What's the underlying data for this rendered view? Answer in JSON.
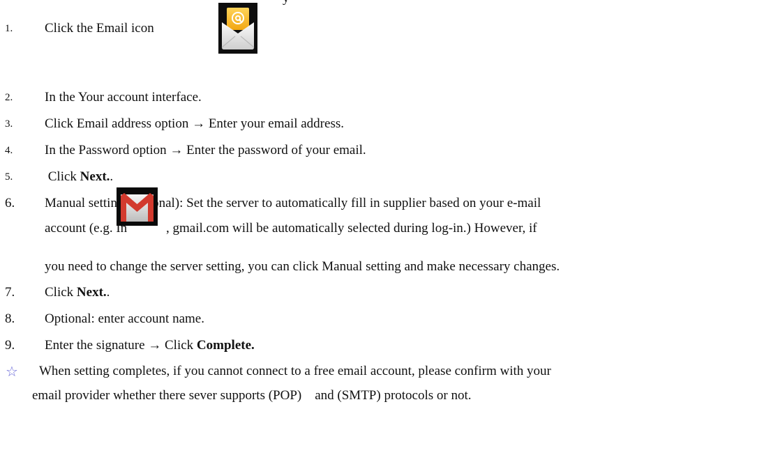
{
  "header_fragment": "y",
  "steps": [
    {
      "num": "1.",
      "parts": [
        {
          "text": "Click the Email icon",
          "bold": false
        }
      ]
    },
    {
      "num": "2.",
      "parts": [
        {
          "text": "In the Your account interface.",
          "bold": false
        }
      ]
    },
    {
      "num": "3.",
      "parts": [
        {
          "text": "Click Email address option → Enter your email address.",
          "bold": false
        }
      ]
    },
    {
      "num": "4.",
      "parts": [
        {
          "text": "In the Password option → Enter the password of your email.",
          "bold": false
        }
      ]
    },
    {
      "num": "5.",
      "parts": [
        {
          "text": " Click ",
          "bold": false
        },
        {
          "text": "Next.",
          "bold": true
        },
        {
          "text": ".",
          "bold": false
        }
      ]
    },
    {
      "num": "6.",
      "line1": "Manual setting (optional): Set the server to automatically fill in supplier based on your e-mail",
      "line2a": "account (e.g. In",
      "line2b": ", gmail.com will be automatically selected during log-in.) However, if",
      "line3": "you need to change the server setting, you can click Manual setting and make necessary changes."
    },
    {
      "num": "7.",
      "parts": [
        {
          "text": "Click ",
          "bold": false
        },
        {
          "text": "Next.",
          "bold": true
        },
        {
          "text": ".",
          "bold": false
        }
      ]
    },
    {
      "num": "8.",
      "parts": [
        {
          "text": "Optional: enter account name.",
          "bold": false
        }
      ]
    },
    {
      "num": "9.",
      "parts": [
        {
          "text": "Enter the signature → Click ",
          "bold": false
        },
        {
          "text": "Complete.",
          "bold": true
        }
      ]
    }
  ],
  "note": {
    "symbol": "☆",
    "line1": "When setting completes, if you cannot connect to a free email account, please confirm with your",
    "line2": "email provider whether there sever supports (POP)    and (SMTP) protocols or not."
  },
  "icons": {
    "email": "email-app-icon",
    "gmail": "gmail-app-icon"
  },
  "colors": {
    "text": "#111111",
    "star": "#6a6ad8",
    "email_icon_yellow": "#f5b51c",
    "gmail_red": "#d23a2e"
  }
}
